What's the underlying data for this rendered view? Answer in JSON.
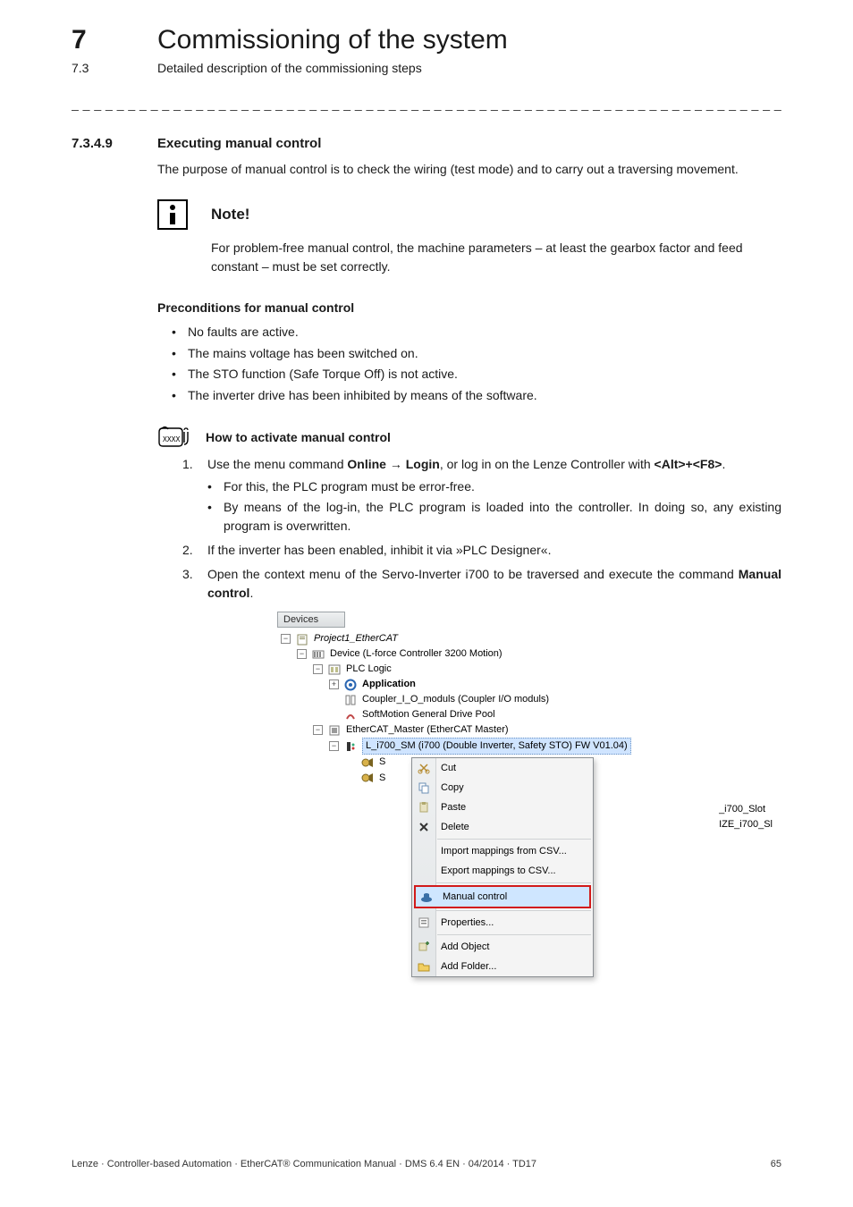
{
  "header": {
    "chapter_number": "7",
    "chapter_title": "Commissioning of the system",
    "section_number": "7.3",
    "section_title": "Detailed description of the commissioning steps"
  },
  "section": {
    "num": "7.3.4.9",
    "title": "Executing manual control",
    "intro": "The purpose of manual control is to check the wiring (test mode) and to carry out a traversing movement."
  },
  "note": {
    "label": "Note!",
    "body": "For problem-free manual control, the machine parameters – at least the gearbox factor and feed constant – must be set correctly."
  },
  "preconditions": {
    "heading": "Preconditions for manual control",
    "items": [
      "No faults are active.",
      "The mains voltage has been switched on.",
      "The STO function (Safe Torque Off) is not active.",
      "The inverter drive has been inhibited by means of the software."
    ]
  },
  "howto": {
    "heading": "How to activate manual control",
    "steps": {
      "s1_pre": "Use the menu command ",
      "s1_cmd": "Online → Login",
      "s1_mid": ", or log in on the Lenze Controller with ",
      "s1_key": "<Alt>+<F8>",
      "s1_suffix": ".",
      "s1_sub": [
        "For this, the PLC program must be error-free.",
        "By means of the log-in, the PLC program is loaded into the controller. In doing so, any existing program is overwritten."
      ],
      "s2": "If the inverter has been enabled, inhibit it via »PLC Designer«.",
      "s3_pre": "Open the context menu of the Servo-Inverter i700 to be traversed and execute the command ",
      "s3_cmd": "Manual control",
      "s3_suffix": "."
    }
  },
  "devices_panel": {
    "title": "Devices",
    "tree": {
      "root": "Project1_EtherCAT",
      "device": "Device (L-force Controller 3200 Motion)",
      "plc_logic": "PLC Logic",
      "application": "Application",
      "coupler": "Coupler_I_O_moduls (Coupler I/O moduls)",
      "softmotion": "SoftMotion General Drive Pool",
      "ecat_master": "EtherCAT_Master (EtherCAT Master)",
      "i700": "L_i700_SM (i700 (Double Inverter, Safety STO) FW V01.04)",
      "child_a_prefix": "S",
      "child_b_prefix": "S",
      "trunc_a": "_i700_Slot",
      "trunc_b": "IZE_i700_Sl"
    },
    "context_menu": {
      "cut": "Cut",
      "copy": "Copy",
      "paste": "Paste",
      "delete": "Delete",
      "import_csv": "Import mappings from CSV...",
      "export_csv": "Export mappings to CSV...",
      "manual_control": "Manual control",
      "properties": "Properties...",
      "add_object": "Add Object",
      "add_folder": "Add Folder..."
    }
  },
  "footer": {
    "left": "Lenze · Controller-based Automation · EtherCAT® Communication Manual · DMS 6.4 EN · 04/2014 · TD17",
    "page": "65"
  },
  "rule": "_ _ _ _ _ _ _ _ _ _ _ _ _ _ _ _ _ _ _ _ _ _ _ _ _ _ _ _ _ _ _ _ _ _ _ _ _ _ _ _ _ _ _ _ _ _ _ _ _ _ _ _ _ _ _ _ _ _ _ _ _ _ _ _"
}
